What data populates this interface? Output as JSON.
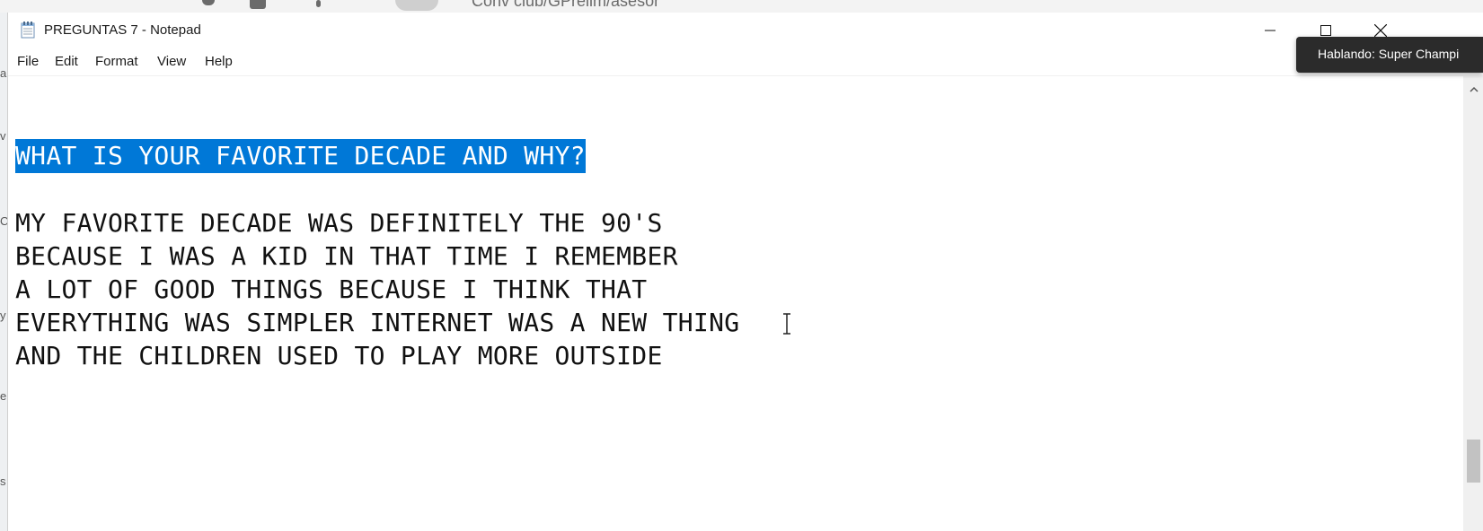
{
  "background": {
    "partial_text": "Conv club/GPrelim/asesor"
  },
  "window": {
    "title": "PREGUNTAS 7 - Notepad",
    "controls": {
      "minimize": "minimize",
      "maximize": "maximize",
      "close": "close"
    }
  },
  "menu": {
    "items": [
      {
        "label": "File"
      },
      {
        "label": "Edit"
      },
      {
        "label": "Format"
      },
      {
        "label": "View"
      },
      {
        "label": "Help"
      }
    ]
  },
  "editor": {
    "selected_line": "WHAT IS YOUR FAVORITE DECADE AND WHY?",
    "lines": [
      "MY FAVORITE DECADE WAS DEFINITELY THE 90'S",
      "BECAUSE I WAS A KID IN THAT TIME I REMEMBER",
      "A LOT OF GOOD THINGS BECAUSE I THINK THAT",
      "EVERYTHING WAS SIMPLER INTERNET WAS A NEW THING",
      "AND THE CHILDREN USED TO PLAY MORE OUTSIDE"
    ],
    "selection_color": "#0078d7"
  },
  "tooltip": {
    "text": "Hablando: Super Champi"
  },
  "icons": {
    "app": "notepad-icon",
    "minimize": "minimize-icon",
    "maximize": "maximize-icon",
    "close": "close-icon",
    "scroll_up": "chevron-up-icon",
    "cursor": "text-cursor-icon"
  }
}
